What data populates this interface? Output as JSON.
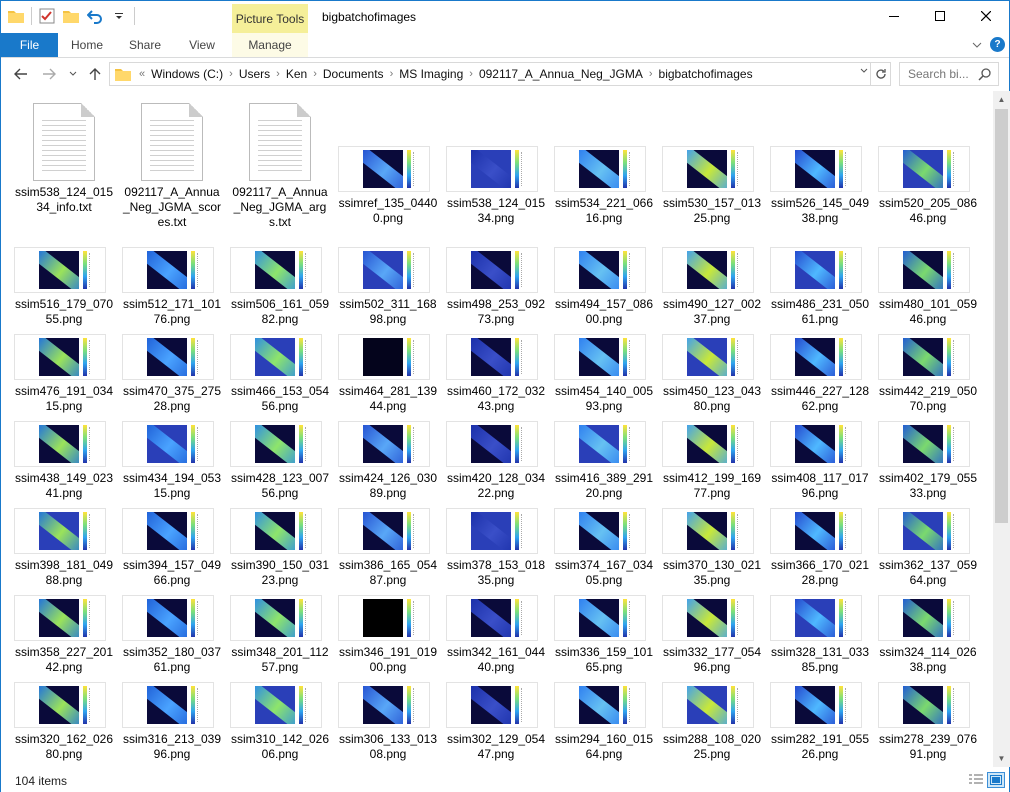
{
  "window": {
    "title": "bigbatchofimages",
    "context_tab": "Picture Tools",
    "controls": [
      "minimize",
      "maximize",
      "close"
    ]
  },
  "ribbon": {
    "tabs": [
      "File",
      "Home",
      "Share",
      "View",
      "Manage"
    ]
  },
  "address": {
    "overflow": "«",
    "crumbs": [
      "Windows (C:)",
      "Users",
      "Ken",
      "Documents",
      "MS Imaging",
      "092117_A_Annua_Neg_JGMA",
      "bigbatchofimages"
    ]
  },
  "search": {
    "placeholder": "Search bi..."
  },
  "files": [
    {
      "name": "ssim538_124_01534_info.txt",
      "type": "txt"
    },
    {
      "name": "092117_A_Annua_Neg_JGMA_scores.txt",
      "type": "txt"
    },
    {
      "name": "092117_A_Annua_Neg_JGMA_args.txt",
      "type": "txt"
    },
    {
      "name": "ssimref_135_04400.png",
      "type": "png"
    },
    {
      "name": "ssim538_124_01534.png",
      "type": "png"
    },
    {
      "name": "ssim534_221_06616.png",
      "type": "png"
    },
    {
      "name": "ssim530_157_01325.png",
      "type": "png"
    },
    {
      "name": "ssim526_145_04938.png",
      "type": "png"
    },
    {
      "name": "ssim520_205_08646.png",
      "type": "png"
    },
    {
      "name": "ssim516_179_07055.png",
      "type": "png"
    },
    {
      "name": "ssim512_171_10176.png",
      "type": "png"
    },
    {
      "name": "ssim506_161_05982.png",
      "type": "png"
    },
    {
      "name": "ssim502_311_16898.png",
      "type": "png"
    },
    {
      "name": "ssim498_253_09273.png",
      "type": "png"
    },
    {
      "name": "ssim494_157_08600.png",
      "type": "png"
    },
    {
      "name": "ssim490_127_00237.png",
      "type": "png"
    },
    {
      "name": "ssim486_231_05061.png",
      "type": "png"
    },
    {
      "name": "ssim480_101_05946.png",
      "type": "png"
    },
    {
      "name": "ssim476_191_03415.png",
      "type": "png"
    },
    {
      "name": "ssim470_375_27528.png",
      "type": "png"
    },
    {
      "name": "ssim466_153_05456.png",
      "type": "png"
    },
    {
      "name": "ssim464_281_13944.png",
      "type": "png"
    },
    {
      "name": "ssim460_172_03243.png",
      "type": "png"
    },
    {
      "name": "ssim454_140_00593.png",
      "type": "png"
    },
    {
      "name": "ssim450_123_04380.png",
      "type": "png"
    },
    {
      "name": "ssim446_227_12862.png",
      "type": "png"
    },
    {
      "name": "ssim442_219_05070.png",
      "type": "png"
    },
    {
      "name": "ssim438_149_02341.png",
      "type": "png"
    },
    {
      "name": "ssim434_194_05315.png",
      "type": "png"
    },
    {
      "name": "ssim428_123_00756.png",
      "type": "png"
    },
    {
      "name": "ssim424_126_03089.png",
      "type": "png"
    },
    {
      "name": "ssim420_128_03422.png",
      "type": "png"
    },
    {
      "name": "ssim416_389_29120.png",
      "type": "png"
    },
    {
      "name": "ssim412_199_16977.png",
      "type": "png"
    },
    {
      "name": "ssim408_117_01796.png",
      "type": "png"
    },
    {
      "name": "ssim402_179_05533.png",
      "type": "png"
    },
    {
      "name": "ssim398_181_04988.png",
      "type": "png"
    },
    {
      "name": "ssim394_157_04966.png",
      "type": "png"
    },
    {
      "name": "ssim390_150_03123.png",
      "type": "png"
    },
    {
      "name": "ssim386_165_05487.png",
      "type": "png"
    },
    {
      "name": "ssim378_153_01835.png",
      "type": "png"
    },
    {
      "name": "ssim374_167_03405.png",
      "type": "png"
    },
    {
      "name": "ssim370_130_02135.png",
      "type": "png"
    },
    {
      "name": "ssim366_170_02128.png",
      "type": "png"
    },
    {
      "name": "ssim362_137_05964.png",
      "type": "png"
    },
    {
      "name": "ssim358_227_20142.png",
      "type": "png"
    },
    {
      "name": "ssim352_180_03761.png",
      "type": "png"
    },
    {
      "name": "ssim348_201_11257.png",
      "type": "png"
    },
    {
      "name": "ssim346_191_01900.png",
      "type": "png"
    },
    {
      "name": "ssim342_161_04440.png",
      "type": "png"
    },
    {
      "name": "ssim336_159_10165.png",
      "type": "png"
    },
    {
      "name": "ssim332_177_05496.png",
      "type": "png"
    },
    {
      "name": "ssim328_131_03385.png",
      "type": "png"
    },
    {
      "name": "ssim324_114_02638.png",
      "type": "png"
    },
    {
      "name": "ssim320_162_02680.png",
      "type": "png"
    },
    {
      "name": "ssim316_213_03996.png",
      "type": "png"
    },
    {
      "name": "ssim310_142_02606.png",
      "type": "png"
    },
    {
      "name": "ssim306_133_01308.png",
      "type": "png"
    },
    {
      "name": "ssim302_129_05447.png",
      "type": "png"
    },
    {
      "name": "ssim294_160_01564.png",
      "type": "png"
    },
    {
      "name": "ssim288_108_02025.png",
      "type": "png"
    },
    {
      "name": "ssim282_191_05526.png",
      "type": "png"
    },
    {
      "name": "ssim278_239_07691.png",
      "type": "png"
    }
  ],
  "status": {
    "item_count": "104 items"
  },
  "colors": {
    "accent": "#1979ca",
    "context_tab": "#f5ef99"
  }
}
